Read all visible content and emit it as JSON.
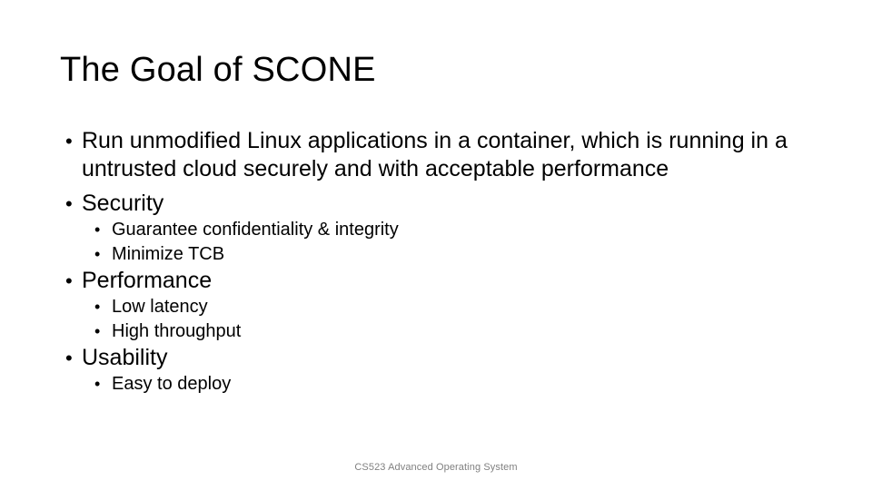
{
  "slide": {
    "title": "The Goal of SCONE",
    "bullets": [
      {
        "level": 1,
        "text": "Run unmodified Linux applications in a container, which is running in a untrusted cloud securely and with acceptable performance"
      },
      {
        "level": 1,
        "text": "Security",
        "children": [
          {
            "level": 2,
            "text": "Guarantee confidentiality & integrity"
          },
          {
            "level": 2,
            "text": "Minimize TCB"
          }
        ]
      },
      {
        "level": 1,
        "text": "Performance",
        "children": [
          {
            "level": 2,
            "text": "Low latency"
          },
          {
            "level": 2,
            "text": "High throughput"
          }
        ]
      },
      {
        "level": 1,
        "text": "Usability",
        "children": [
          {
            "level": 2,
            "text": "Easy to deploy"
          }
        ]
      }
    ],
    "footer": "CS523 Advanced Operating System",
    "colors": {
      "background": "#ffffff",
      "text": "#000000",
      "footer_text": "#808080"
    }
  }
}
